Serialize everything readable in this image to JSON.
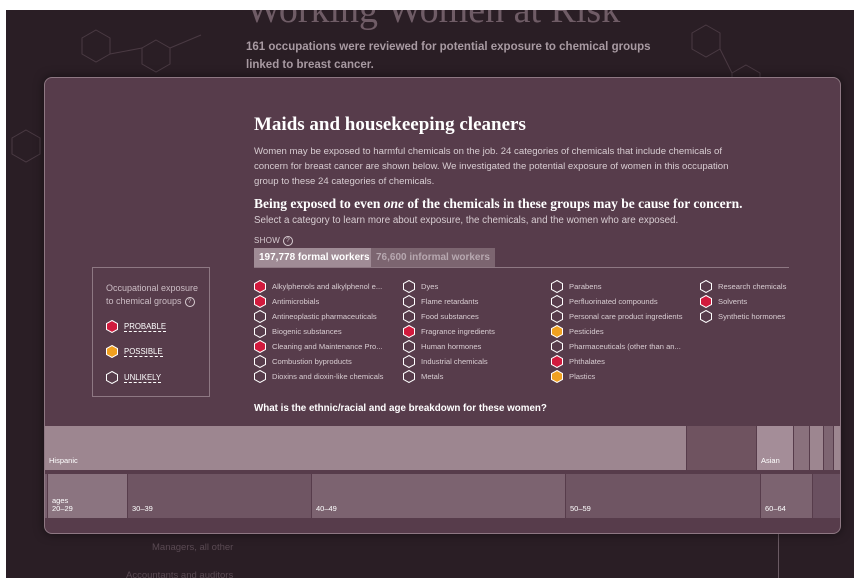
{
  "background": {
    "title": "Working Women at Risk",
    "subtitle": "161 occupations were reviewed for potential exposure to chemical groups linked to breast cancer.",
    "list_items": [
      "Managers, all other",
      "Accountants and auditors"
    ]
  },
  "modal": {
    "title": "Maids and housekeeping cleaners",
    "intro": "Women may be exposed to harmful chemicals on the job. 24 categories of chemicals that include chemicals of concern for breast cancer are shown below. We investigated the potential exposure of women in this occupation group to these 24 categories of chemicals.",
    "question_pre": "Being exposed to even ",
    "question_em": "one",
    "question_post": " of the chemicals in these groups may be cause for concern.",
    "hint": "Select a category to learn more about exposure, the chemicals, and the women who are exposed.",
    "show_label": "SHOW",
    "help_glyph": "?",
    "tabs": {
      "formal": "197,778 formal workers",
      "informal": "76,600 informal workers"
    },
    "breakdown_question": "What is the ethnic/racial and age breakdown for these women?"
  },
  "legend": {
    "title": "Occupational exposure to chemical groups",
    "probable": "PROBABLE",
    "possible": "POSSIBLE",
    "unlikely": "UNLIKELY"
  },
  "colors": {
    "probable": "#d11a3d",
    "possible": "#f0a020",
    "unlikely": "none",
    "modal_bg": "#573c4b"
  },
  "chemicals": [
    {
      "label": "Alkylphenols and alkylphenol e...",
      "status": "probable"
    },
    {
      "label": "Antimicrobials",
      "status": "probable"
    },
    {
      "label": "Antineoplastic pharmaceuticals",
      "status": "unlikely"
    },
    {
      "label": "Biogenic substances",
      "status": "unlikely"
    },
    {
      "label": "Cleaning and Maintenance Pro...",
      "status": "probable"
    },
    {
      "label": "Combustion byproducts",
      "status": "unlikely"
    },
    {
      "label": "Dioxins and dioxin-like chemicals",
      "status": "unlikely"
    },
    {
      "label": "Dyes",
      "status": "unlikely"
    },
    {
      "label": "Flame retardants",
      "status": "unlikely"
    },
    {
      "label": "Food substances",
      "status": "unlikely"
    },
    {
      "label": "Fragrance ingredients",
      "status": "probable"
    },
    {
      "label": "Human hormones",
      "status": "unlikely"
    },
    {
      "label": "Industrial chemicals",
      "status": "unlikely"
    },
    {
      "label": "Metals",
      "status": "unlikely"
    },
    {
      "label": "Parabens",
      "status": "unlikely"
    },
    {
      "label": "Perfluorinated compounds",
      "status": "unlikely"
    },
    {
      "label": "Personal care product ingredients",
      "status": "unlikely"
    },
    {
      "label": "Pesticides",
      "status": "possible"
    },
    {
      "label": "Pharmaceuticals (other than an...",
      "status": "unlikely"
    },
    {
      "label": "Phthalates",
      "status": "probable"
    },
    {
      "label": "Plastics",
      "status": "possible"
    },
    {
      "label": "Research chemicals",
      "status": "unlikely"
    },
    {
      "label": "Solvents",
      "status": "probable"
    },
    {
      "label": "Synthetic hormones",
      "status": "unlikely"
    }
  ],
  "ethnicity": [
    {
      "label": "Hispanic",
      "share": 0.808,
      "color": "#9d8690"
    },
    {
      "label": "",
      "share": 0.088,
      "color": "#6f5360"
    },
    {
      "label": "Asian",
      "share": 0.046,
      "color": "#a48d98"
    },
    {
      "label": "",
      "share": 0.02,
      "color": "#8a717d"
    },
    {
      "label": "",
      "share": 0.018,
      "color": "#9d8690"
    },
    {
      "label": "",
      "share": 0.012,
      "color": "#7e6572"
    },
    {
      "label": "",
      "share": 0.008,
      "color": "#9d8690"
    }
  ],
  "ages": [
    {
      "label": "",
      "share": 0.004,
      "color": "#7a6170"
    },
    {
      "label": "ages\n20–29",
      "share": 0.1,
      "color": "#8b7480"
    },
    {
      "label": "30–39",
      "share": 0.231,
      "color": "#6f5563"
    },
    {
      "label": "40–49",
      "share": 0.32,
      "color": "#7c6370"
    },
    {
      "label": "50–59",
      "share": 0.245,
      "color": "#6f5563"
    },
    {
      "label": "60–64",
      "share": 0.065,
      "color": "#7c6370"
    },
    {
      "label": "",
      "share": 0.035,
      "color": "#6a5060"
    }
  ]
}
